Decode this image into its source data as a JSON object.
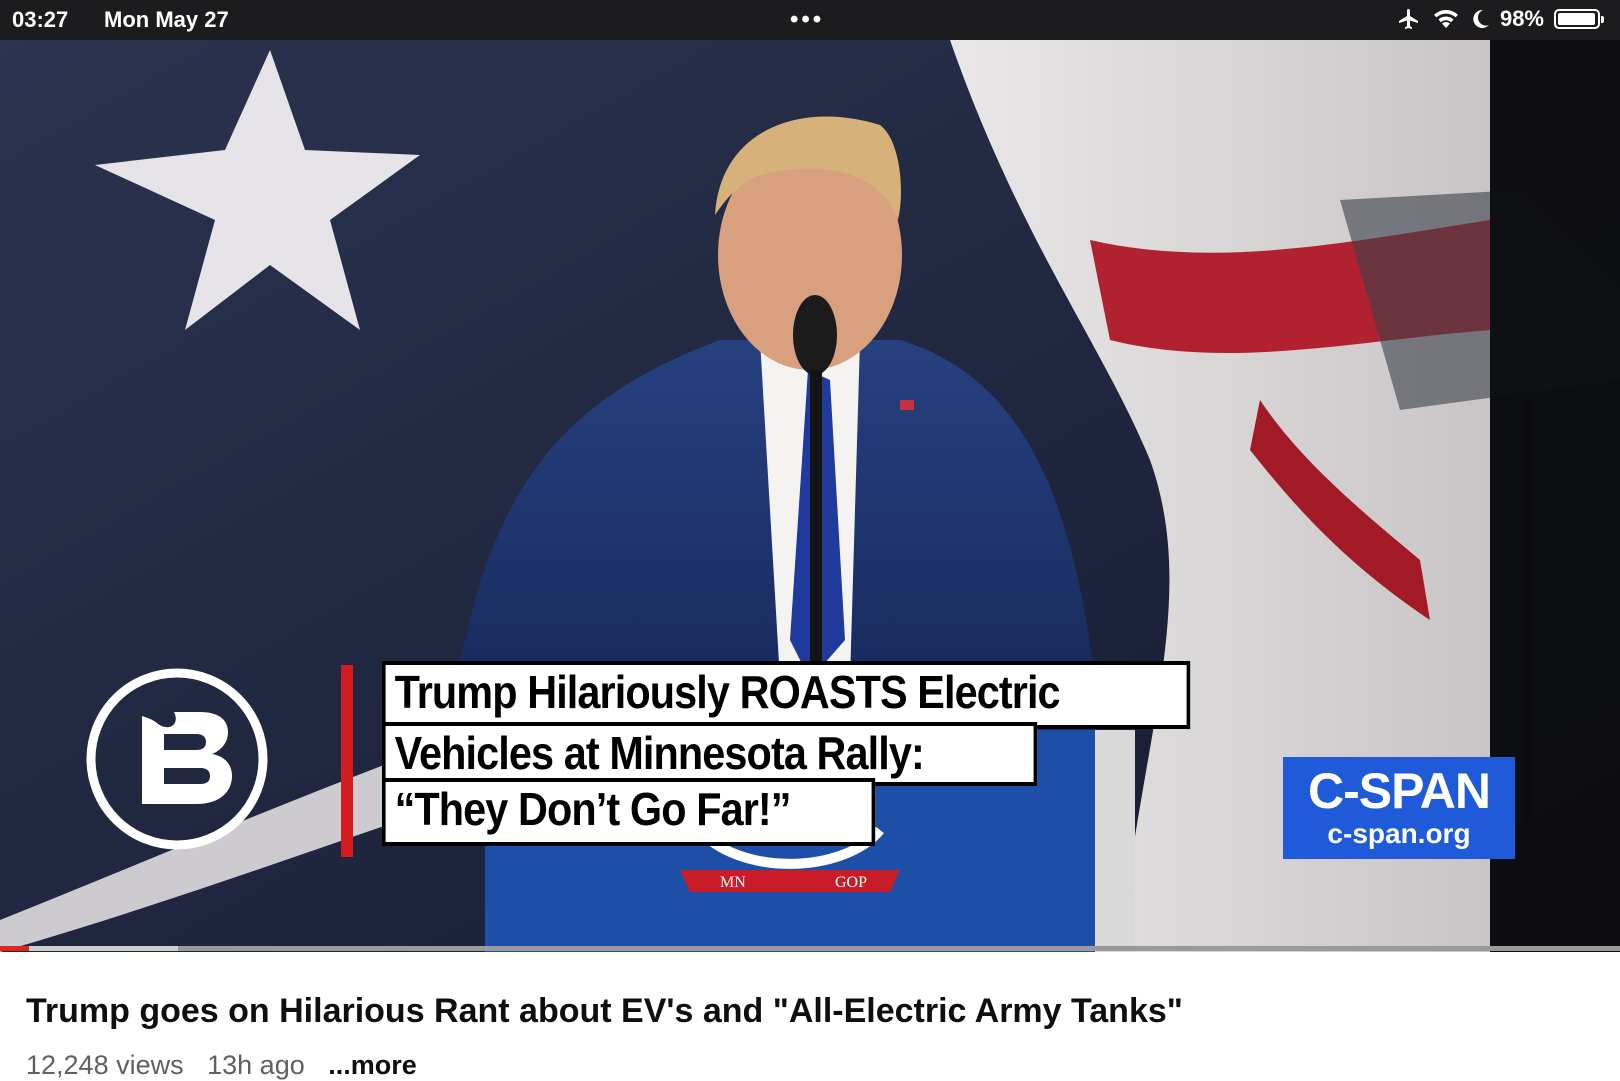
{
  "status_bar": {
    "time": "03:27",
    "date": "Mon May 27",
    "dots": "•••",
    "battery_percent": "98%",
    "battery_level": 0.98,
    "icons": [
      "airplane-icon",
      "wifi-icon",
      "moon-icon",
      "battery-icon"
    ]
  },
  "video": {
    "overlay_title_lines": [
      "Trump Hilariously ROASTS Electric",
      "Vehicles at Minnesota Rally:",
      "“They Don’t Go Far!”"
    ],
    "network_badge": {
      "name": "C-SPAN",
      "url": "c-span.org"
    },
    "podium_labels": [
      "MN",
      "GOP"
    ],
    "progress": 0.018,
    "buffered": 0.11
  },
  "metadata": {
    "title": "Trump goes on Hilarious Rant about EV's and \"All-Electric Army Tanks\"",
    "views": "12,248 views",
    "age": "13h ago",
    "more": "...more"
  },
  "colors": {
    "status_bar_bg": "#1c1c1e",
    "progress_red": "#e0261c",
    "cspan_blue": "#1f5bd9",
    "suit_blue": "#1d2f6b",
    "title_bar_red": "#d51a20"
  }
}
